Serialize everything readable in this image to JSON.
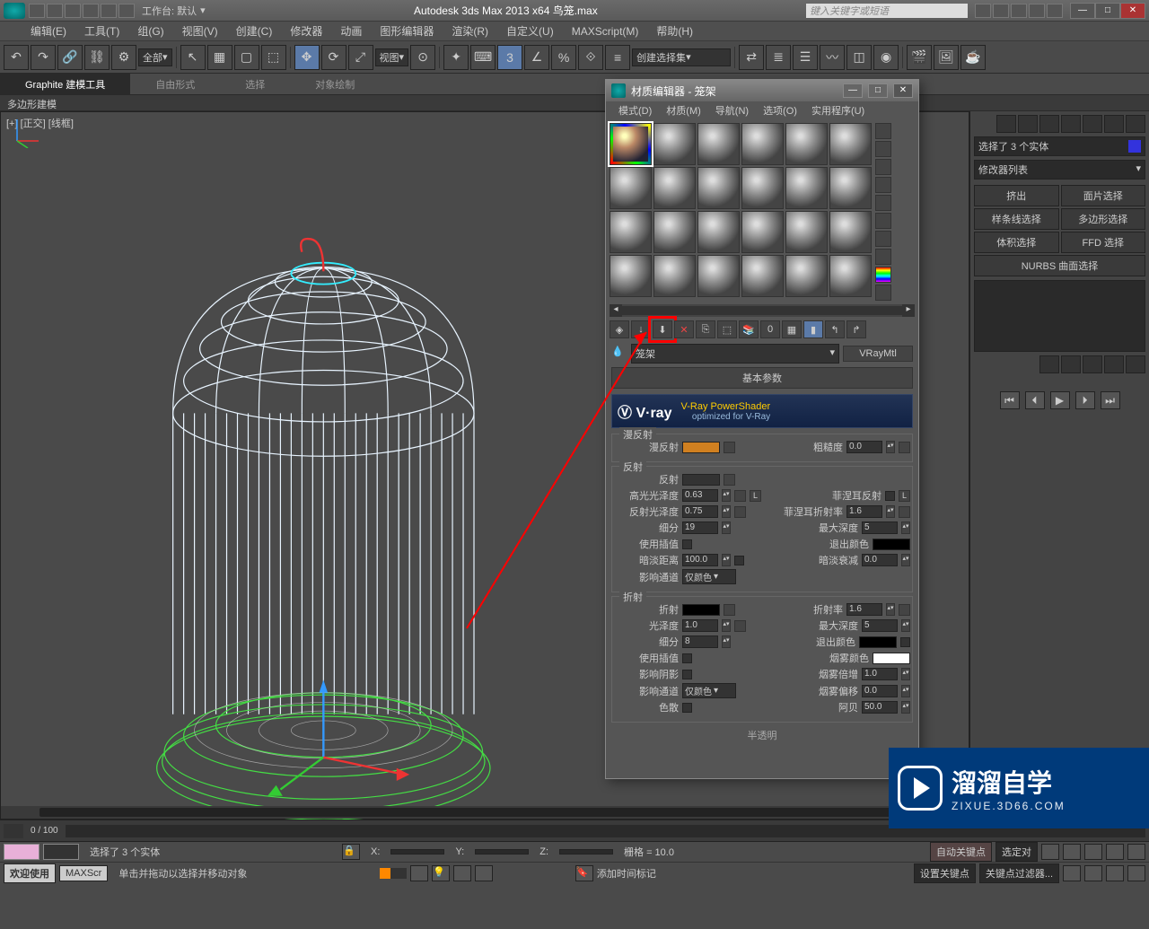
{
  "titlebar": {
    "workspace_label": "工作台: 默认",
    "app_title": "Autodesk 3ds Max  2013 x64   鸟笼.max",
    "search_placeholder": "键入关键字或短语"
  },
  "menu": [
    "编辑(E)",
    "工具(T)",
    "组(G)",
    "视图(V)",
    "创建(C)",
    "修改器",
    "动画",
    "图形编辑器",
    "渲染(R)",
    "自定义(U)",
    "MAXScript(M)",
    "帮助(H)"
  ],
  "toolbar": {
    "filter": "全部",
    "viewmode": "视图",
    "create_set": "创建选择集"
  },
  "ribbon": {
    "tabs": [
      "Graphite 建模工具",
      "自由形式",
      "选择",
      "对象绘制"
    ],
    "sub": "多边形建模"
  },
  "viewport": {
    "label": "[+] [正交] [线框]"
  },
  "right_panel": {
    "selection": "选择了 3 个实体",
    "modlist": "修改器列表",
    "buttons": [
      [
        "挤出",
        "面片选择"
      ],
      [
        "样条线选择",
        "多边形选择"
      ],
      [
        "体积选择",
        "FFD 选择"
      ]
    ],
    "nurbs": "NURBS 曲面选择"
  },
  "timeline": {
    "frame": "0 / 100"
  },
  "status": {
    "sel": "选择了 3 个实体",
    "hint": "单击并拖动以选择并移动对象",
    "welcome": "欢迎使用",
    "maxscr": "MAXScr",
    "x": "X:",
    "y": "Y:",
    "z": "Z:",
    "grid": "栅格 = 10.0",
    "autokey": "自动关键点",
    "selset": "选定对",
    "setkey": "设置关键点",
    "keyfilter": "关键点过滤器...",
    "addmark": "添加时间标记"
  },
  "mateditor": {
    "title": "材质编辑器 - 笼架",
    "menu": [
      "模式(D)",
      "材质(M)",
      "导航(N)",
      "选项(O)",
      "实用程序(U)"
    ],
    "mat_name": "笼架",
    "mat_type": "VRayMtl",
    "rollout_basic": "基本参数",
    "vray_brand": "V·ray",
    "vray_ps": "V-Ray PowerShader",
    "vray_opt": "optimized for V-Ray",
    "grp_diffuse": "漫反射",
    "diffuse_lbl": "漫反射",
    "rough_lbl": "粗糙度",
    "rough_val": "0.0",
    "grp_reflect": "反射",
    "reflect_lbl": "反射",
    "hglossy_lbl": "高光光泽度",
    "hglossy_val": "0.63",
    "rglossy_lbl": "反射光泽度",
    "rglossy_val": "0.75",
    "subdiv_lbl": "细分",
    "subdiv_val": "19",
    "useinterp_lbl": "使用插值",
    "dimdist_lbl": "暗淡距离",
    "dimdist_val": "100.0",
    "affect_lbl": "影响通道",
    "affect_val": "仅颜色",
    "fresnel_lbl": "菲涅耳反射",
    "fresnelior_lbl": "菲涅耳折射率",
    "fresnelior_val": "1.6",
    "maxdepth_lbl": "最大深度",
    "maxdepth_val": "5",
    "exitcolor_lbl": "退出颜色",
    "dimfall_lbl": "暗淡衰减",
    "dimfall_val": "0.0",
    "L": "L",
    "grp_refract": "折射",
    "refract_lbl": "折射",
    "ior_lbl": "折射率",
    "ior_val": "1.6",
    "glossy_lbl": "光泽度",
    "glossy_val": "1.0",
    "rmaxdepth_val": "5",
    "rsubdiv_lbl": "细分",
    "rsubdiv_val": "8",
    "rexit_lbl": "退出颜色",
    "ruseinterp_lbl": "使用插值",
    "fogcolor_lbl": "烟雾颜色",
    "affectsh_lbl": "影响阴影",
    "fogmult_lbl": "烟雾倍增",
    "fogmult_val": "1.0",
    "raffect_lbl": "影响通道",
    "raffect_val": "仅颜色",
    "fogbias_lbl": "烟雾偏移",
    "fogbias_val": "0.0",
    "disp_lbl": "色散",
    "abbe_lbl": "阿贝",
    "abbe_val": "50.0",
    "rollout_half": "半透明"
  },
  "watermark": {
    "big": "溜溜自学",
    "small": "ZIXUE.3D66.COM"
  }
}
